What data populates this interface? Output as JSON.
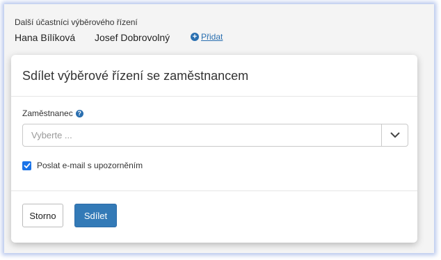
{
  "background": {
    "participants_title": "Další účastníci výběrového řízení",
    "participants": [
      "Hana Bílíková",
      "Josef Dobrovolný"
    ],
    "add_label": "Přidat"
  },
  "modal": {
    "title": "Sdílet výběrové řízení se zaměstnancem",
    "employee_label": "Zaměstnanec",
    "employee_placeholder": "Vyberte ...",
    "notify_label": "Poslat e-mail s upozorněním",
    "notify_checked": true,
    "cancel_label": "Storno",
    "share_label": "Sdílet"
  },
  "icons": {
    "add": "plus-circle-icon",
    "help": "question-circle-icon",
    "dropdown": "chevron-down-icon",
    "check": "check-icon"
  },
  "colors": {
    "accent": "#337ab7",
    "link": "#2a6fb0",
    "checkbox": "#1a73e8"
  }
}
